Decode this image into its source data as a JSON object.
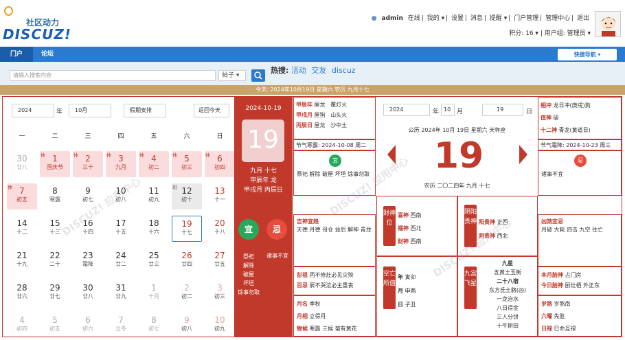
{
  "header": {
    "logo_cn": "社区动力",
    "logo_en": "DISCUZ!",
    "top_links": [
      "admin",
      "在线",
      "我的 ▾",
      "设置",
      "消息",
      "提醒 ▾",
      "门户管理",
      "管理中心",
      "退出"
    ],
    "credits": "积分: 16 ▾",
    "usergroup": "用户组: 管理员 ▾"
  },
  "nav": {
    "items": [
      "门户",
      "论坛"
    ],
    "quick": "快捷导航 ▾"
  },
  "search": {
    "placeholder": "请输入搜索内容",
    "scope": "帖子 ▾",
    "hot_label": "热搜:",
    "hot": [
      "活动",
      "交友",
      "discuz"
    ]
  },
  "today_bar": "今天: 2024年10月19日  星期六  农历 九月十七",
  "calendar": {
    "year": "2024",
    "year_unit": "年",
    "month": "10月",
    "holiday_select": "假期安排",
    "today_button": "返回今天",
    "weekdays": [
      "一",
      "二",
      "三",
      "四",
      "五",
      "六",
      "日"
    ],
    "weeks": [
      [
        {
          "n": "30",
          "s": "廿八",
          "c": "off"
        },
        {
          "n": "1",
          "s": "国庆节",
          "c": "hol",
          "t": "休"
        },
        {
          "n": "2",
          "s": "三十",
          "c": "hol",
          "t": "休"
        },
        {
          "n": "3",
          "s": "九月",
          "c": "hol",
          "t": "休"
        },
        {
          "n": "4",
          "s": "初二",
          "c": "hol",
          "t": "休"
        },
        {
          "n": "5",
          "s": "初三",
          "c": "hol",
          "t": "休"
        },
        {
          "n": "6",
          "s": "初四",
          "c": "hol",
          "t": "休"
        }
      ],
      [
        {
          "n": "7",
          "s": "初五",
          "c": "hol",
          "t": "休"
        },
        {
          "n": "8",
          "s": "寒露",
          "c": ""
        },
        {
          "n": "9",
          "s": "初七",
          "c": ""
        },
        {
          "n": "10",
          "s": "初八",
          "c": ""
        },
        {
          "n": "11",
          "s": "初九",
          "c": ""
        },
        {
          "n": "12",
          "s": "初十",
          "c": "wk2",
          "t": "班"
        },
        {
          "n": "13",
          "s": "十一",
          "c": "red"
        }
      ],
      [
        {
          "n": "14",
          "s": "十二",
          "c": ""
        },
        {
          "n": "15",
          "s": "十三",
          "c": ""
        },
        {
          "n": "16",
          "s": "十四",
          "c": ""
        },
        {
          "n": "17",
          "s": "十五",
          "c": ""
        },
        {
          "n": "18",
          "s": "十六",
          "c": ""
        },
        {
          "n": "19",
          "s": "十七",
          "c": "sel"
        },
        {
          "n": "20",
          "s": "十八",
          "c": "red"
        }
      ],
      [
        {
          "n": "21",
          "s": "十九",
          "c": ""
        },
        {
          "n": "22",
          "s": "二十",
          "c": ""
        },
        {
          "n": "23",
          "s": "霜降",
          "c": ""
        },
        {
          "n": "24",
          "s": "廿二",
          "c": ""
        },
        {
          "n": "25",
          "s": "廿三",
          "c": ""
        },
        {
          "n": "26",
          "s": "廿四",
          "c": "red"
        },
        {
          "n": "27",
          "s": "廿五",
          "c": "red"
        }
      ],
      [
        {
          "n": "28",
          "s": "廿六",
          "c": ""
        },
        {
          "n": "29",
          "s": "廿七",
          "c": ""
        },
        {
          "n": "30",
          "s": "廿八",
          "c": ""
        },
        {
          "n": "31",
          "s": "廿九",
          "c": ""
        },
        {
          "n": "1",
          "s": "十月",
          "c": "off"
        },
        {
          "n": "2",
          "s": "初二",
          "c": "redoff"
        },
        {
          "n": "3",
          "s": "初三",
          "c": "redoff"
        }
      ],
      [
        {
          "n": "4",
          "s": "初四",
          "c": "off"
        },
        {
          "n": "5",
          "s": "初五",
          "c": "off"
        },
        {
          "n": "6",
          "s": "初六",
          "c": "off"
        },
        {
          "n": "7",
          "s": "立冬",
          "c": "off"
        },
        {
          "n": "8",
          "s": "初七",
          "c": "off"
        },
        {
          "n": "9",
          "s": "初八",
          "c": "redoff"
        },
        {
          "n": "10",
          "s": "初九",
          "c": "redoff"
        }
      ]
    ]
  },
  "daypanel": {
    "date": "2024-10-19",
    "day": "19",
    "lunar1": "九月 十七",
    "lunar2": "甲辰年 龙",
    "lunar3": "甲戌月 丙辰日",
    "yi": "宜",
    "ji": "忌",
    "yi_items": [
      "祭祀",
      "解除",
      "破屋",
      "坏垣",
      "馀事勿取"
    ],
    "ji_items": "诸事不宜"
  },
  "ganzhi": [
    [
      "甲辰年",
      "覆灯火",
      "屋龙"
    ],
    [
      "甲戌月",
      "山头火",
      "屋狗"
    ],
    [
      "丙辰日",
      "沙中土",
      "屋龙"
    ]
  ],
  "jieqi_left": "节气寒露: 2024-10-08 周二",
  "yi_seal": "宜",
  "yi_text": "祭祀 解除 破屋 坏垣 馀事勿取",
  "mid": {
    "year": "2024",
    "nian": "年",
    "month": "10",
    "yue": "月",
    "day": "19",
    "ri": "日",
    "gongli": "公历 2024年 10月 19日 星期六 天秤座",
    "big": "19",
    "nongli": "农历 二〇二四年 九月 十七"
  },
  "right_top": [
    [
      "相冲",
      "龙日冲(庚戌)狗"
    ],
    [
      "值神",
      "破"
    ],
    [
      "十二神",
      "青龙(黄道日)"
    ]
  ],
  "jieqi_right": "节气霜降: 2024-10-23 周三",
  "ji_seal": "忌",
  "ji_text": "诸事不宜",
  "jishen": {
    "title": "吉神宜趋",
    "text": "天德 月德 母仓 益后 解神 青龙"
  },
  "caishen": {
    "vt": "财神位",
    "rows": [
      [
        "喜神",
        "西南"
      ],
      [
        "福神",
        "西北"
      ],
      [
        "财神",
        "西南"
      ]
    ]
  },
  "yinyang": {
    "vt": "阴阳贵神",
    "rows": [
      [
        "阳贵神",
        "正西"
      ],
      [
        "阴贵神",
        "西北"
      ]
    ]
  },
  "xiongsha": {
    "title": "凶煞宜忌",
    "text": "月破 大耗 四击 九空 往亡"
  },
  "pengzu": [
    [
      "彭祖",
      "丙不修灶必见灾殃"
    ],
    [
      "百忌",
      "辰不哭泣必主重丧"
    ]
  ],
  "kongwang": {
    "vt": "空亡所值",
    "rows": [
      [
        "年",
        "寅卯"
      ],
      [
        "月",
        "申酉"
      ],
      [
        "日",
        "子丑"
      ]
    ]
  },
  "jiugong": {
    "vt": "九宫飞星",
    "rows": [
      "九星",
      "五黄土玉衡",
      "二十八宿",
      "东方氐土貉(凶)",
      "一龙治水",
      "八日得金",
      "三人分饼",
      "十牛耕田"
    ]
  },
  "taishen": [
    [
      "本月胎神",
      "占门房"
    ],
    [
      "今日胎神",
      "厨灶栖 外正东"
    ]
  ],
  "left_bottom": [
    [
      "月名",
      "季秋"
    ],
    [
      "月相",
      "立得月"
    ],
    [
      "物候",
      "寒露 三候 菊有黄花"
    ]
  ],
  "right_bottom": [
    [
      "岁煞",
      "岁煞南"
    ],
    [
      "六曜",
      "先胜"
    ],
    [
      "日禄",
      "巳命互禄"
    ]
  ],
  "watermark": "DISCUZ! 应用中心 · 贰道 · addon.dismall.com",
  "colors": {
    "brand": "#2b7acd",
    "red": "#c0392b",
    "gold": "#c9a46a"
  }
}
